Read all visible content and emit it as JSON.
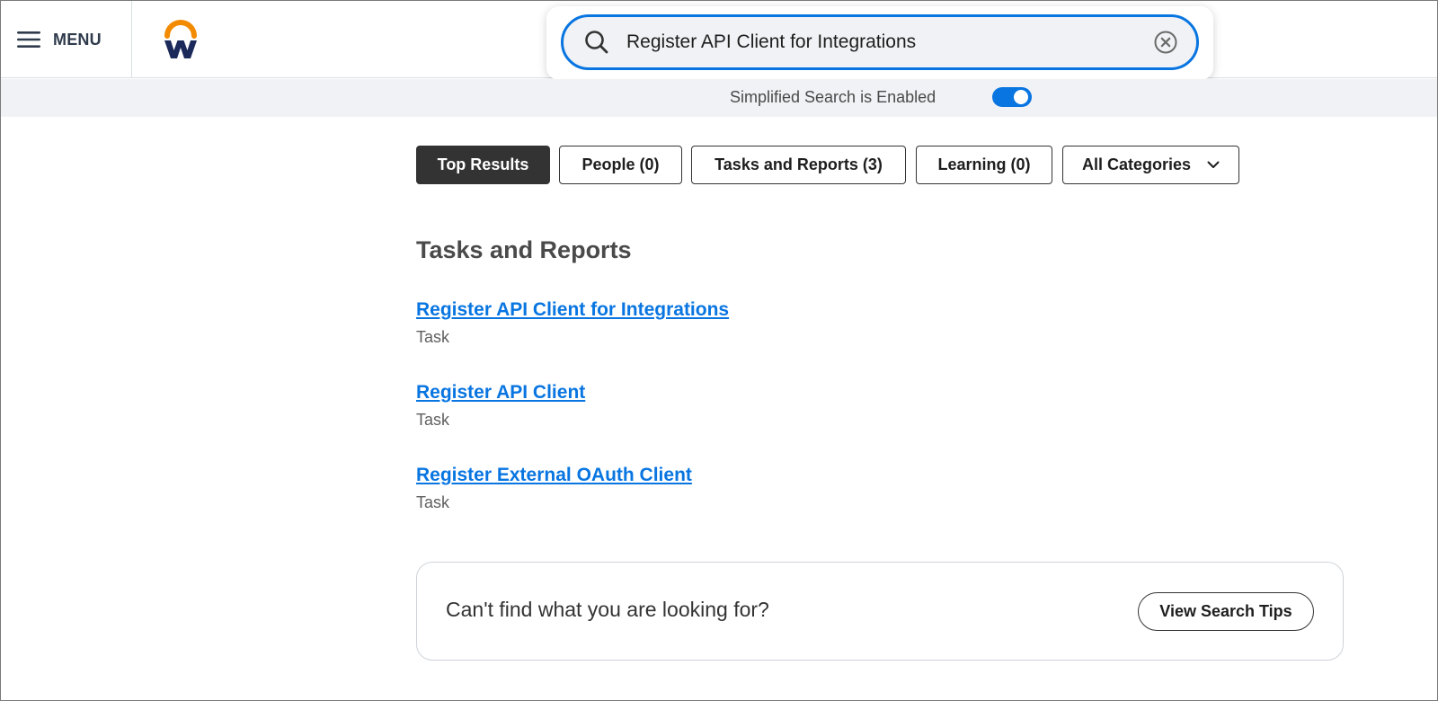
{
  "header": {
    "menu_label": "MENU",
    "logo_icon": "workday-logo-icon",
    "menu_icon": "hamburger-menu-icon"
  },
  "search": {
    "value": "Register API Client for Integrations",
    "search_icon": "search-icon",
    "clear_icon": "clear-circle-icon",
    "focus_color": "#0875e1"
  },
  "simplified_search": {
    "label": "Simplified Search is Enabled",
    "enabled": true,
    "color": "#0875e1"
  },
  "tabs": [
    {
      "label": "Top Results",
      "active": true
    },
    {
      "label": "People (0)",
      "active": false
    },
    {
      "label": "Tasks and Reports (3)",
      "active": false
    },
    {
      "label": "Learning (0)",
      "active": false
    },
    {
      "label": "All Categories",
      "active": false,
      "icon": "chevron-down-icon"
    }
  ],
  "results_section": {
    "title": "Tasks and Reports",
    "items": [
      {
        "title": "Register API Client for Integrations",
        "type": "Task"
      },
      {
        "title": "Register API Client",
        "type": "Task"
      },
      {
        "title": "Register External OAuth Client",
        "type": "Task"
      }
    ]
  },
  "help": {
    "text": "Can't find what you are looking for?",
    "button_label": "View Search Tips"
  },
  "colors": {
    "link": "#0875e1",
    "active_tab": "#333333",
    "logo_orange": "#f38b00",
    "logo_navy": "#005cb9"
  }
}
